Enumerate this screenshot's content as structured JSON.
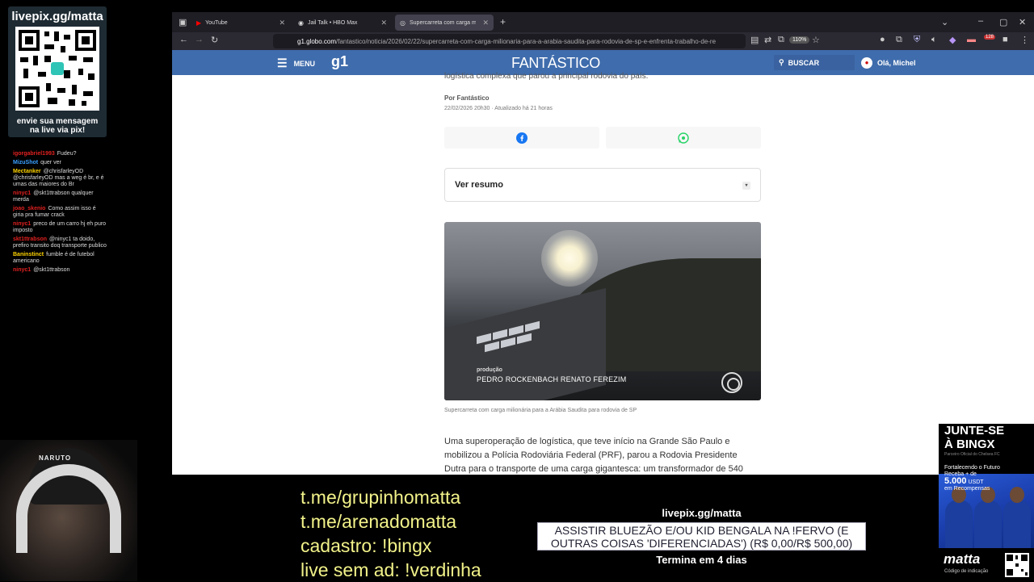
{
  "overlay": {
    "qr_title": "livepix.gg/matta",
    "qr_caption": "envie sua mensagem na live via pix!",
    "chat": [
      {
        "user": "igorgabriel1993",
        "text": "Fudeu?",
        "color": "#e02020"
      },
      {
        "user": "MizuShot",
        "text": "quer ver",
        "color": "#3aa0ff"
      },
      {
        "user": "Mectanker",
        "text": "@chrisfarleyOD @chrisfarleyOD mas a weg é br, e é umas das maiores do Br",
        "color": "#ffd400"
      },
      {
        "user": "ninyc1",
        "text": "@skt1ttrabson qualquer merda",
        "color": "#e02020"
      },
      {
        "user": "joao_skenio",
        "text": "Como assim isso é giria pra fumar crack",
        "color": "#e02020"
      },
      {
        "user": "ninyc1",
        "text": "preco de um carro hj eh puro imposto",
        "color": "#e02020"
      },
      {
        "user": "skt1ttrabson",
        "text": "@ninyc1 ta doido, prefiro transito doq transporte publico",
        "color": "#e02020"
      },
      {
        "user": "Baninstinct",
        "text": "fumble é de futebol americano",
        "color": "#ffd400"
      },
      {
        "user": "ninyc1",
        "text": "@skt1ttrabson",
        "color": "#e02020"
      }
    ],
    "links": [
      "t.me/grupinhomatta",
      "t.me/arenadomatta",
      "cadastro: !bingx",
      "live sem ad: !verdinha"
    ],
    "pix_title": "livepix.gg/matta",
    "pix_goal": "ASSISTIR BLUEZÃO E/OU KID BENGALA NA !FERVO (E OUTRAS COISAS 'DIFERENCIADAS') (R$ 0,00/R$ 500,00)",
    "pix_ends": "Termina em 4 dias",
    "cap_text": "NARUTO",
    "bingx": {
      "head": "JUNTE-SE\nÀ BINGX",
      "sub": "Parceiro Oficial do Chelsea FC",
      "promo_line1": "Fortalecendo o Futuro",
      "promo_line2": "Receba + de",
      "amount": "5.000",
      "currency": "USDT",
      "promo_line3": "em Recompensas",
      "logo": "matta",
      "logo_sub": "Código de indicação"
    }
  },
  "browser": {
    "tabs": [
      {
        "label": "YouTube",
        "icon": "youtube-icon"
      },
      {
        "label": "Jail Talk • HBO Max",
        "icon": "hbo-icon"
      },
      {
        "label": "Supercarreta com carga mil",
        "icon": "globo-icon",
        "active": true
      }
    ],
    "url_host": "g1.globo.com",
    "url_path": "/fantastico/noticia/2026/02/22/supercarreta-com-carga-milionaria-para-a-arabia-saudita-para-rodovia-de-sp-e-enfrenta-trabalho-de-re",
    "zoom": "110%",
    "badge_count": "128"
  },
  "site": {
    "menu_label": "MENU",
    "logo": "g1",
    "program": "FANTÁSTICO",
    "search_label": "BUSCAR",
    "user_greeting": "Olá, Michel"
  },
  "article": {
    "lead_cut": "logística complexa que parou a principal rodovia do país.",
    "byline": "Por Fantástico",
    "dateline": "22/02/2026 20h30 · Atualizado há 21 horas",
    "summary_label": "Ver resumo",
    "video_credit_label": "produção",
    "video_credit_names": "PEDRO ROCKENBACH   RENATO FEREZIM",
    "caption": "Supercarreta com carga milionária para a Arábia Saudita para rodovia de SP",
    "body": "Uma superoperação de logística, que teve início na Grande São Paulo e mobilizou a Polícia Rodoviária Federal (PRF), parou a Rodovia Presidente Dutra para o transporte de uma carga gigantesca: um transformador de 540"
  }
}
